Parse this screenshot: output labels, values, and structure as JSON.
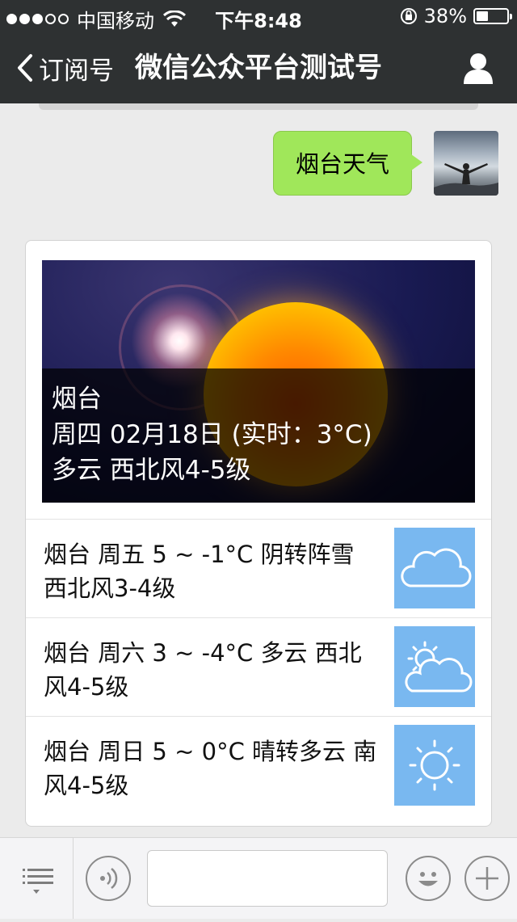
{
  "status_bar": {
    "carrier": "中国移动",
    "time": "下午8:48",
    "battery": "38%",
    "signal_bars_filled": 3,
    "signal_bars_total": 5,
    "battery_level": 0.38
  },
  "nav": {
    "back_label": "订阅号",
    "title": "微信公众平台测试号",
    "profile_icon": "person-icon"
  },
  "chat": {
    "sent_message": "烟台天气"
  },
  "weather_card": {
    "hero": {
      "city": "烟台",
      "date_line": "周四 02月18日 (实时：3°C)",
      "condition_line": "多云 西北风4-5级"
    },
    "forecast": [
      {
        "text": "烟台 周五 5 ~ -1°C 阴转阵雪 西北风3-4级",
        "icon": "cloud-icon"
      },
      {
        "text": "烟台 周六 3 ~ -4°C 多云 西北风4-5级",
        "icon": "partly-cloudy-icon"
      },
      {
        "text": "烟台 周日 5 ~ 0°C 晴转多云 南风4-5级",
        "icon": "sun-icon"
      }
    ]
  },
  "input_bar": {
    "placeholder": "",
    "icons": [
      "menu-icon",
      "voice-icon",
      "emoji-icon",
      "plus-icon"
    ]
  },
  "colors": {
    "nav_bg": "#2e3132",
    "bubble": "#a0e75a",
    "icon_bg": "#79b8f0",
    "chat_bg": "#ebebeb"
  }
}
